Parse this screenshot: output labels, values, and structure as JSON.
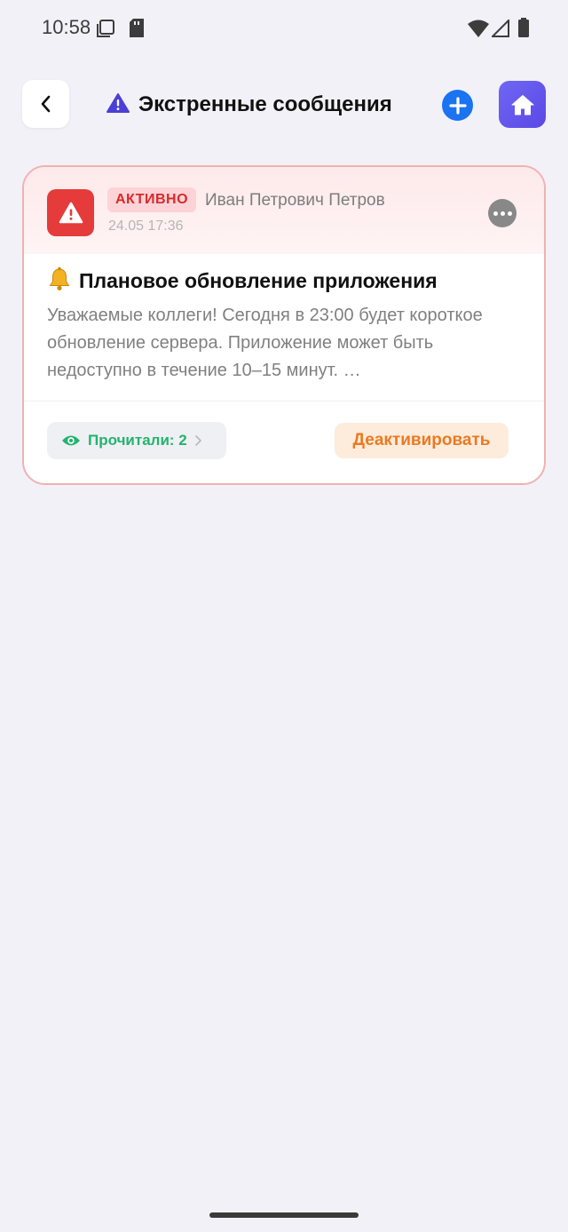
{
  "status_bar": {
    "time": "10:58"
  },
  "header": {
    "title": "Экстренные сообщения"
  },
  "message": {
    "status_badge": "АКТИВНО",
    "author": "Иван Петрович Петров",
    "datetime": "24.05 17:36",
    "title": "Плановое обновление приложения",
    "body": "Уважаемые коллеги! Сегодня в 23:00 будет короткое обновление сервера. Приложение может быть недоступно в течение 10–15 минут. …",
    "read_label": "Прочитали: 2",
    "deactivate_label": "Деактивировать"
  },
  "colors": {
    "accent_blue": "#1a73f0",
    "accent_purple": "#5b48e6",
    "danger": "#e53b3b",
    "success": "#22b46e",
    "warning": "#ea7a22"
  },
  "icons": [
    "back-chevron-icon",
    "warning-triangle-icon",
    "plus-icon",
    "home-icon",
    "bell-icon",
    "eye-icon",
    "more-dots-icon",
    "chevron-right-icon"
  ]
}
